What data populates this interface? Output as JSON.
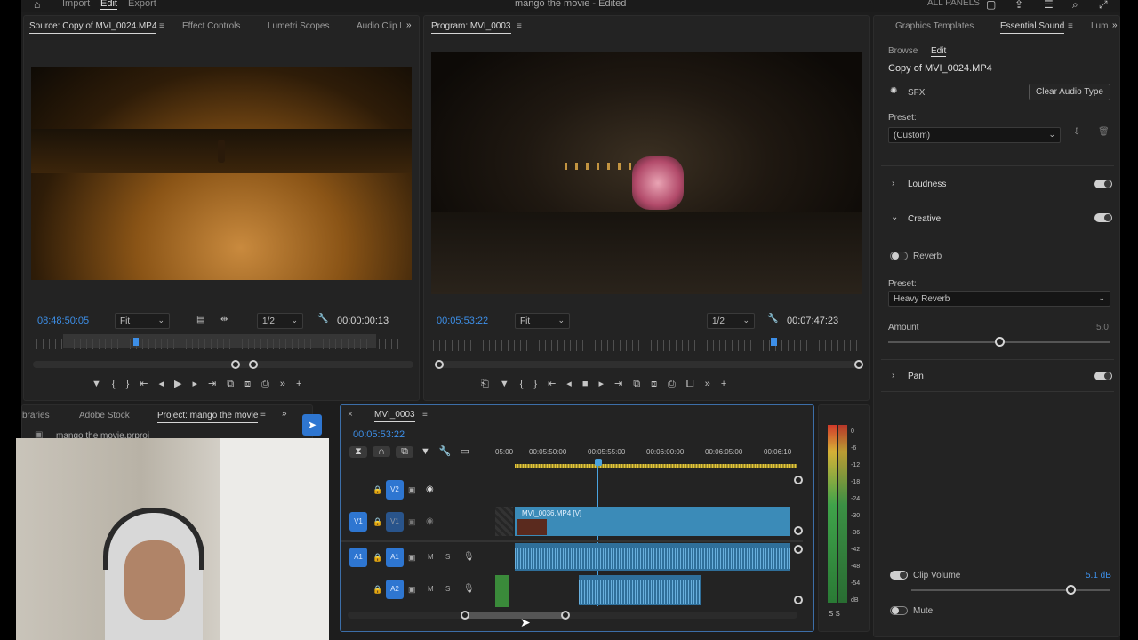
{
  "topbar": {
    "nav": [
      "Import",
      "Edit",
      "Export"
    ],
    "title": "mango the movie - Edited",
    "all_panels": "ALL PANELS"
  },
  "source": {
    "tabs": [
      "Source: Copy of MVI_0024.MP4",
      "Effect Controls",
      "Lumetri Scopes",
      "Audio Clip M"
    ],
    "timecode": "08:48:50:05",
    "fit": "Fit",
    "resolution": "1/2",
    "duration": "00:00:00:13"
  },
  "program": {
    "tab": "Program: MVI_0003",
    "timecode": "00:05:53:22",
    "fit": "Fit",
    "resolution": "1/2",
    "duration": "00:07:47:23"
  },
  "project": {
    "tabs": [
      "braries",
      "Adobe Stock",
      "Project: mango the movie"
    ],
    "file": "mango the movie.prproj"
  },
  "timeline": {
    "sequence": "MVI_0003",
    "timecode": "00:05:53:22",
    "ruler": [
      "05:00",
      "00:05:50:00",
      "00:05:55:00",
      "00:06:00:00",
      "00:06:05:00",
      "00:06:10"
    ],
    "tracks": [
      {
        "name": "V2",
        "source": ""
      },
      {
        "name": "V1",
        "source": "V1"
      },
      {
        "name": "A1",
        "source": "A1",
        "m": "M",
        "s": "S"
      },
      {
        "name": "A2",
        "source": "",
        "m": "M",
        "s": "S"
      }
    ],
    "video_clip": "MVI_0036.MP4 [V]",
    "meter_scale": [
      "0",
      "-6",
      "-12",
      "-18",
      "-24",
      "-30",
      "-36",
      "-42",
      "-48",
      "-54",
      "dB"
    ],
    "meter_footer": "S S"
  },
  "essential_sound": {
    "tabs": [
      "Graphics Templates",
      "Essential Sound",
      "Lum"
    ],
    "subtabs": [
      "Browse",
      "Edit"
    ],
    "clip_name": "Copy of MVI_0024.MP4",
    "type": "SFX",
    "clear_button": "Clear Audio Type",
    "preset_label": "Preset:",
    "preset_value": "(Custom)",
    "sections": {
      "loudness": "Loudness",
      "creative": "Creative",
      "pan": "Pan"
    },
    "reverb_label": "Reverb",
    "reverb_preset_label": "Preset:",
    "reverb_preset_value": "Heavy Reverb",
    "amount_label": "Amount",
    "amount_value": "5.0",
    "amount_level": 0.5,
    "clip_volume_label": "Clip Volume",
    "clip_volume_value": "5.1 dB",
    "clip_volume_level": 0.8,
    "mute_label": "Mute"
  },
  "colors": {
    "accent_blue": "#2e76d1",
    "timecode_blue": "#3d8fe8",
    "clip_video": "#3b8bb8",
    "clip_audio": "#2f6f9a",
    "playhead": "#4aa3e0"
  }
}
